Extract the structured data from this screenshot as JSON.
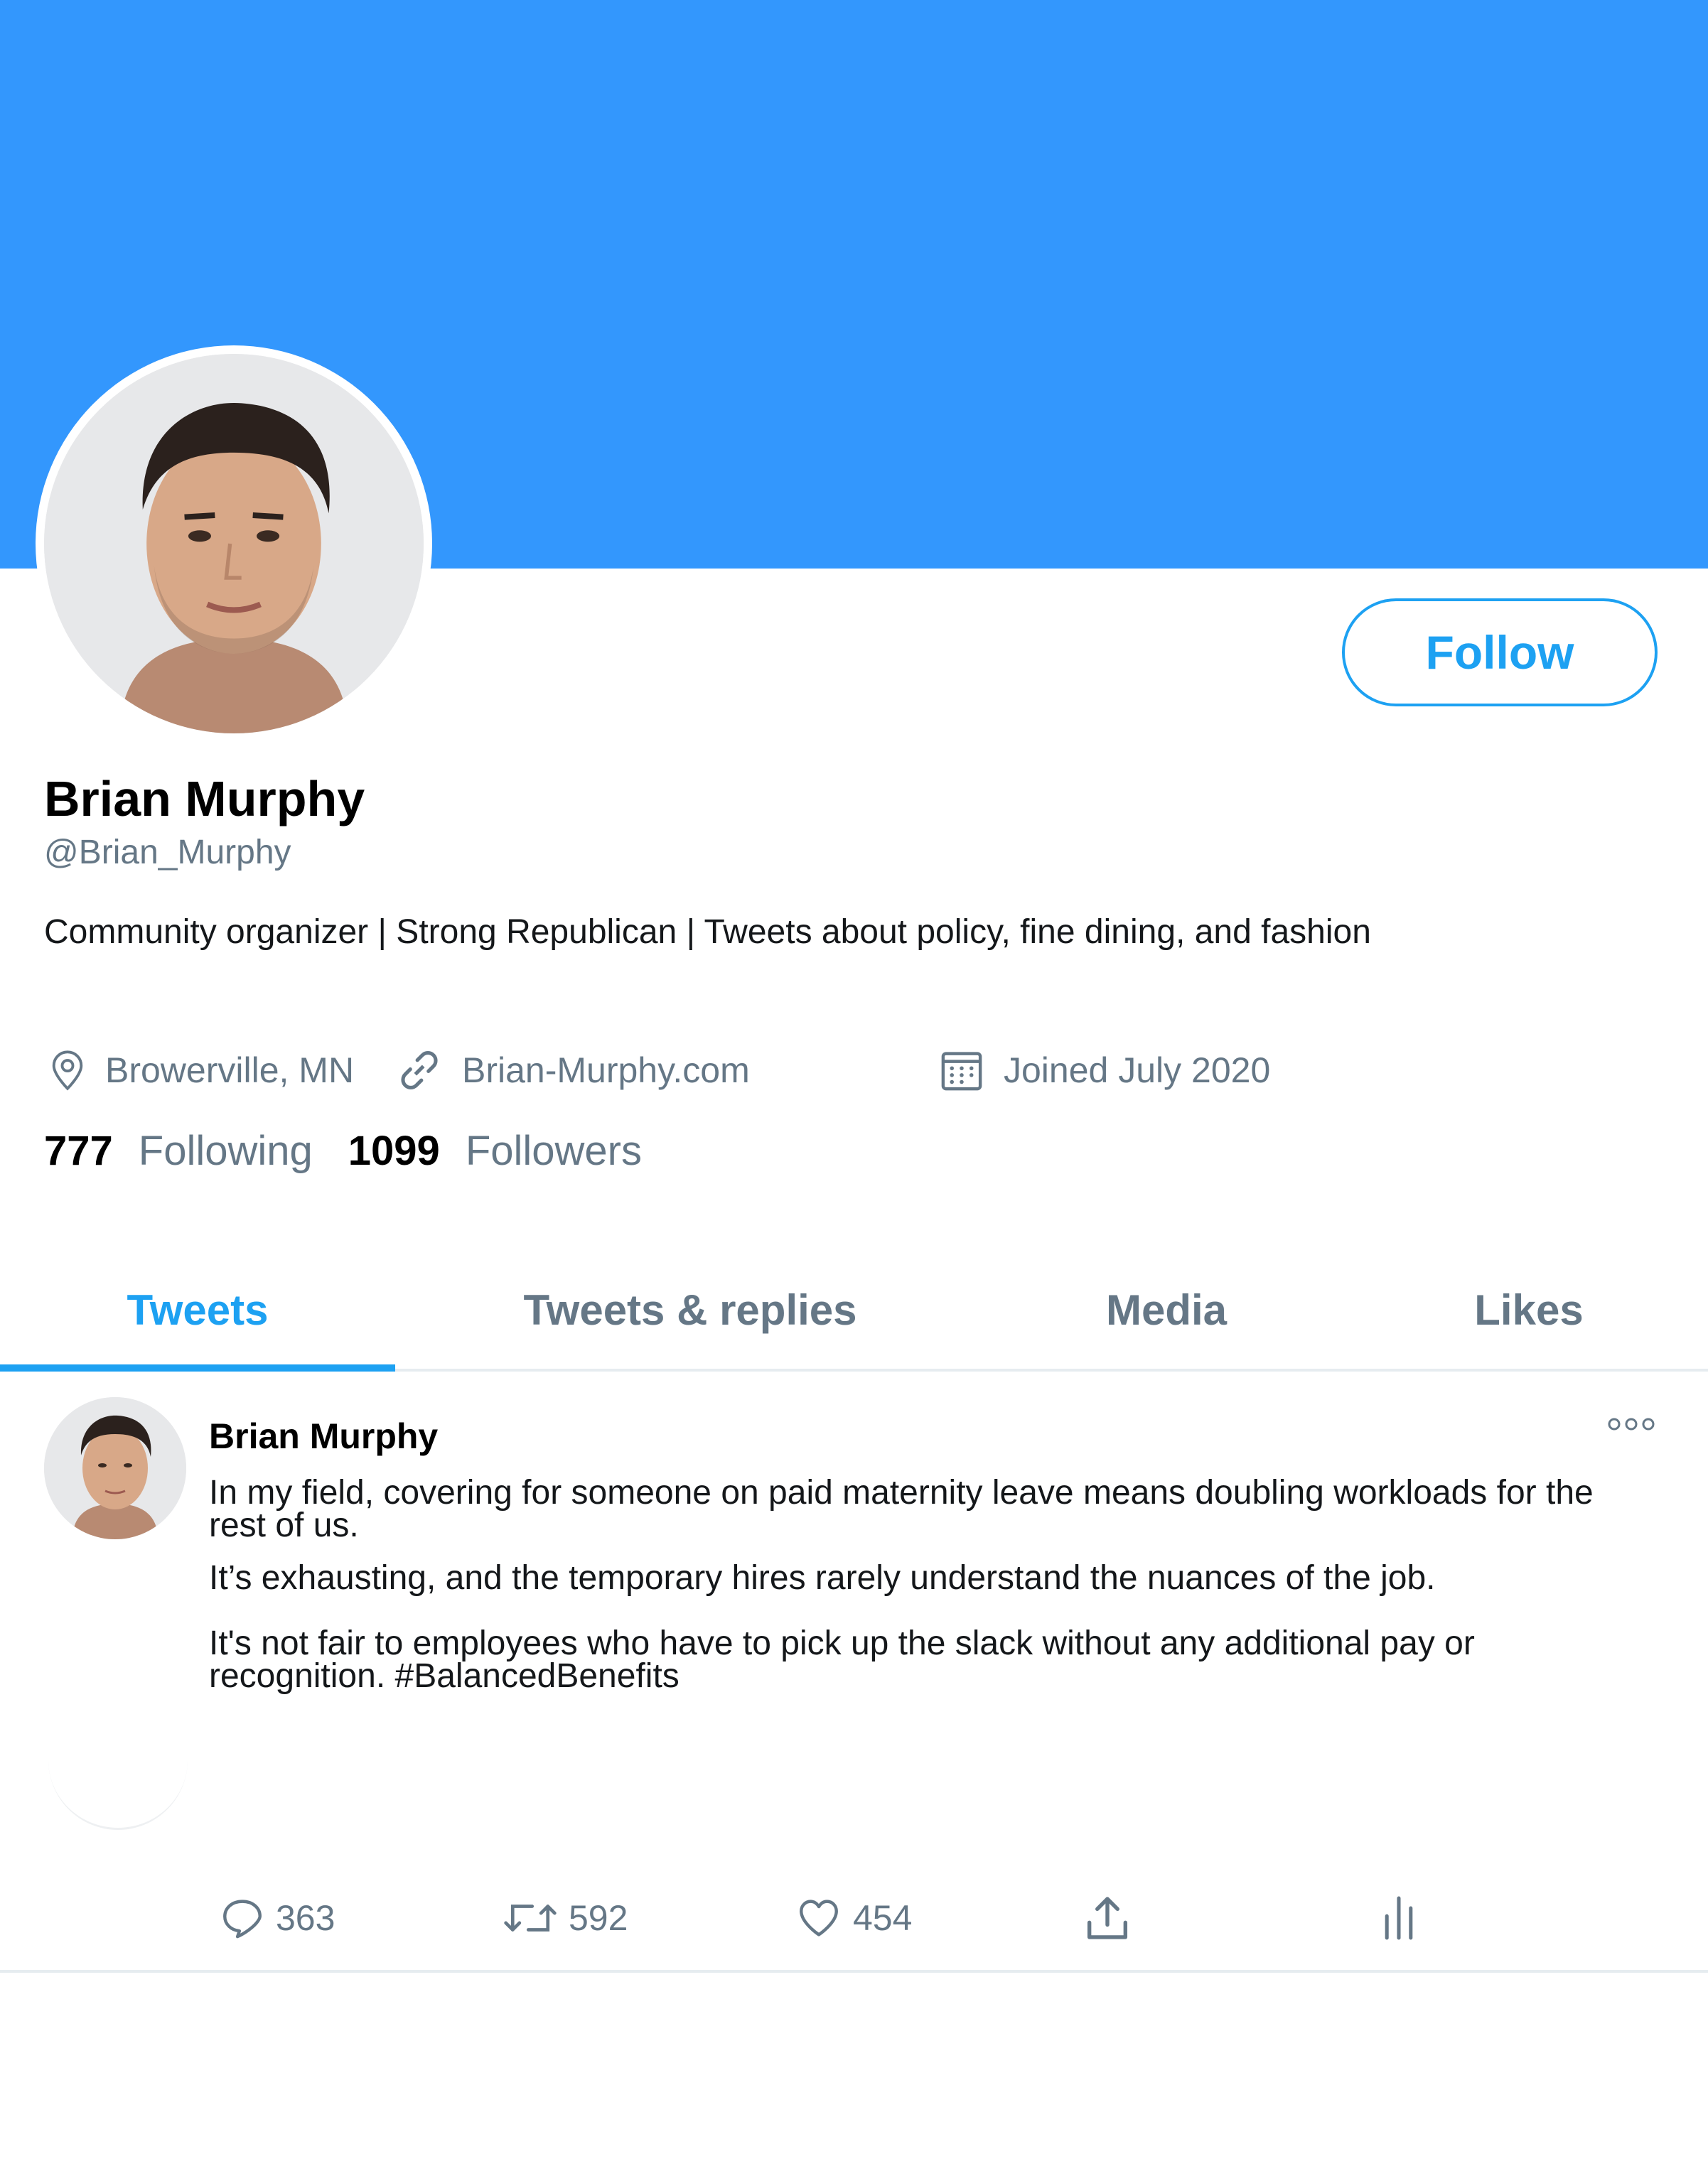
{
  "profile": {
    "name": "Brian Murphy",
    "handle": "@Brian_Murphy",
    "bio": "Community organizer | Strong Republican | Tweets about policy, fine dining, and fashion",
    "location": "Browerville, MN",
    "website": "Brian-Murphy.com",
    "joined": "Joined July 2020",
    "follow_label": "Follow",
    "following_count": "777",
    "following_label": "Following",
    "followers_count": "1099",
    "followers_label": "Followers"
  },
  "tabs": [
    {
      "label": "Tweets",
      "active": true
    },
    {
      "label": "Tweets & replies",
      "active": false
    },
    {
      "label": "Media",
      "active": false
    },
    {
      "label": "Likes",
      "active": false
    }
  ],
  "tweet": {
    "author": "Brian Murphy",
    "paragraph_1": "In my field, covering for someone on paid maternity leave means doubling workloads for the rest of us.",
    "paragraph_2": "It’s exhausting, and the temporary hires rarely understand the nuances of the job.",
    "paragraph_3": "It's not fair to employees who have to pick up the slack without any additional pay or recognition. #BalancedBenefits",
    "replies": "363",
    "retweets": "592",
    "likes": "454"
  },
  "icons": {
    "location": "location-pin-icon",
    "link": "link-icon",
    "calendar": "calendar-icon",
    "more": "more-options-icon",
    "reply": "reply-icon",
    "retweet": "retweet-icon",
    "like": "heart-icon",
    "share": "share-icon",
    "analytics": "analytics-icon"
  },
  "colors": {
    "banner": "#3397fd",
    "accent": "#1da1f2",
    "secondary_text": "#657786",
    "divider": "#e6ecf0"
  }
}
